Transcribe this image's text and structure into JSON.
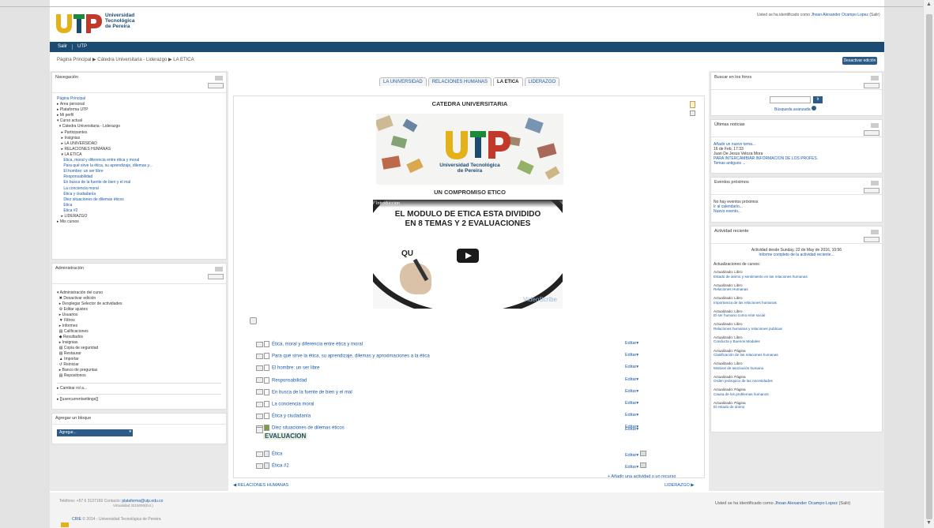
{
  "header": {
    "logo_text": [
      "Universidad",
      "Tecnológica",
      "de Pereira"
    ],
    "login_prefix": "Usted se ha identificado como",
    "login_user": "Jhoan Alexander Ocampo Lopez",
    "logout": "(Salir)"
  },
  "navbar": {
    "items": [
      "Salir",
      "UTP"
    ]
  },
  "breadcrumb": "Página Principal ▶ Cátedra Universitaria - Liderazgo ▶ LA ETICA",
  "edit_button": "Desactivar edición",
  "navigation": {
    "title": "Navegación",
    "items": [
      "Página Principal",
      "▸ Área personal",
      "▸ Plataforma UTP",
      "▸ Mi perfil",
      "▾ Curso actual",
      "  ▾ Cátedra Universitaria - Liderazgo",
      "    ▸ Participantes",
      "    ▸ Insignias",
      "    ▸ LA UNIVERSIDAD",
      "    ▸ RELACIONES HUMANAS",
      "    ▾ LA ETICA",
      "      Ética, moral y diferencia entre ética y moral",
      "      Para qué sirve la ética, su aprendizaje, dilemas y...",
      "      El hombre: un ser libre",
      "      Responsabilidad",
      "      En busca de la fuente de bien y el mal",
      "      La conciencia moral",
      "      Ética y ciudadanía",
      "      Diez situaciones de dilemas éticos",
      "      Ética",
      "      Ética #2",
      "    ▸ LIDERAZGO",
      "▸ Mis cursos"
    ]
  },
  "administration": {
    "title": "Administración",
    "items": [
      "▾ Administración del curso",
      "  ✖ Desactivar edición",
      "  ▸ Desplegar Selector de actividades",
      "  ⚙ Editar ajustes",
      "  ▸ Usuarios",
      "  ▼ Filtros",
      "  ▸ Informes",
      "  ▤ Calificaciones",
      "  ◆ Resultados",
      "  ▸ Insignias",
      "  ▤ Copia de seguridad",
      "  ▤ Restaurar",
      "  ▲ Importar",
      "  ↺ Reiniciar",
      "  ▸ Banco de preguntas",
      "  ▤ Repositorios",
      "▸ Cambiar rol a...",
      "▸ [[usercurrentsettings]]"
    ]
  },
  "add_block": {
    "title": "Agregar un bloque",
    "select": "Agregar..."
  },
  "tabs": [
    "LA UNIVERSIDAD",
    "RELACIONES HUMANAS",
    "LA ETICA",
    "LIDERAZGO"
  ],
  "section": {
    "title": "CATEDRA UNIVERSITARIA",
    "banner_text": [
      "Universidad Tecnológica",
      "de Pereira"
    ],
    "subtitle": "UN COMPROMISO ETICO",
    "video": {
      "label": "Introduccion",
      "line1": "EL MODULO DE ETICA ESTA DIVIDIDO",
      "line2": "EN 8 TEMAS Y 2 EVALUACIONES",
      "partial": "QU",
      "brand": "VideoScribe"
    }
  },
  "activities": [
    "Ética, moral y diferencia entre ética y moral",
    "Para qué sirve la ética, su aprendizaje, dilemas y aproximaciones a la ética",
    "El hombre: un ser libre",
    "Responsabilidad",
    "En busca de la fuente de bien y el mal",
    "La conciencia moral",
    "Ética y ciudadanía",
    "Diez situaciones de dilemas éticos"
  ],
  "edit_label": "Editar",
  "evaluation": {
    "title": "EVALUACION",
    "items": [
      "Ética",
      "Ética #2"
    ]
  },
  "add_activity": "+ Añadir una actividad o un recurso",
  "prev_section": "◀ RELACIONES HUMANAS",
  "next_section": "LIDERAZGO ▶",
  "search_forums": {
    "title": "Buscar en los foros",
    "button": "Ir",
    "advanced": "Búsqueda avanzada"
  },
  "news": {
    "title": "Últimas noticias",
    "lines": [
      "Añadir un nuevo tema...",
      "16 de Feb, 17:33",
      "Juan De Jesus Veloza Mora",
      "PARA INTERCAMBIAR INFORMACION DE LOS PROFES.",
      "Temas antiguos ..."
    ]
  },
  "events": {
    "title": "Eventos próximos",
    "lines": [
      "No hay eventos próximos",
      "Ir al calendario...",
      "Nuevo evento..."
    ]
  },
  "recent": {
    "title": "Actividad reciente",
    "since": "Actividad desde Sunday, 22 de May de 2016, 10:56",
    "report": "Informe completo de la actividad reciente...",
    "updates_title": "Actualizaciones de cursos:",
    "updates": [
      [
        "Actualizado: Libro",
        "Estado de ánimo y sentimiento en las relaciones humanas"
      ],
      [
        "Actualizado: Libro",
        "Relaciones Humanas"
      ],
      [
        "Actualizado: Libro",
        "Importancia de las relaciones humanas"
      ],
      [
        "Actualizado: Libro",
        "El ser humano como ente social"
      ],
      [
        "Actualizado: Libro",
        "Relaciones humanas y relaciones publicas"
      ],
      [
        "Actualizado: Libro",
        "Conducta y Buenos Modales"
      ],
      [
        "Actualizado: Página",
        "Clasificación de las relaciones humanas"
      ],
      [
        "Actualizado: Libro",
        "Motivos de asociación humana"
      ],
      [
        "Actualizado: Página",
        "Orden jerárquico de las necesidades"
      ],
      [
        "Actualizado: Página",
        "Causa de los problemas humanos"
      ],
      [
        "Actualizado: Página",
        "El estado de ánimo"
      ]
    ]
  },
  "footer": {
    "contact": "Teléfono: +57 6 3137169 Contacto:",
    "email": "plataforma@utp.edu.co",
    "sub": "Virtualidad 3215000(Ext.)",
    "crie": "CRIE",
    "copyright": "© 2014 - Universidad Tecnológica de Pereira",
    "login_prefix": "Usted se ha identificado como",
    "login_user": "Jhoan Alexander Ocampo Lopez",
    "logout": "(Salir)"
  },
  "colors": {
    "navbar": "#1b4a72",
    "link": "#1a5aa8",
    "utp_yellow": "#e3b21a",
    "utp_red": "#c0392b"
  }
}
